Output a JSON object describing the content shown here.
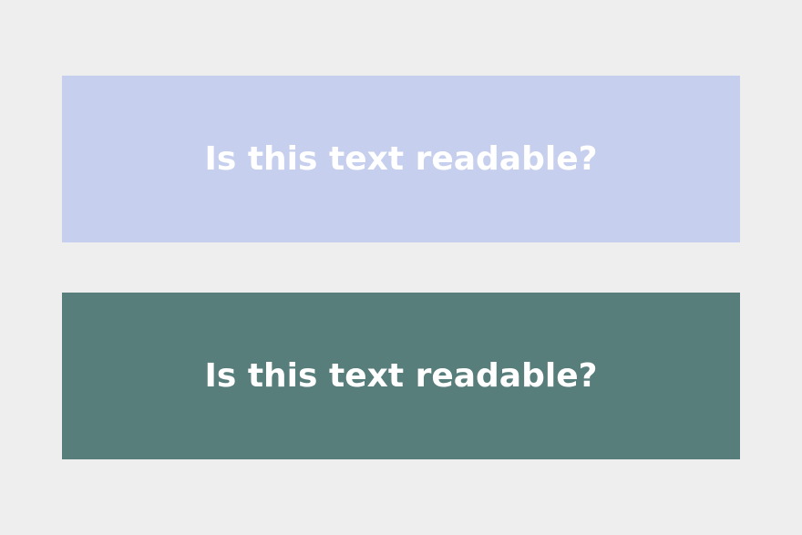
{
  "background_color": "#eeeeee",
  "panels": [
    {
      "text": "Is this text readable?",
      "background_color": "#c6cfed",
      "text_color": "#ffffff"
    },
    {
      "text": "Is this text readable?",
      "background_color": "#587e7b",
      "text_color": "#ffffff"
    }
  ]
}
